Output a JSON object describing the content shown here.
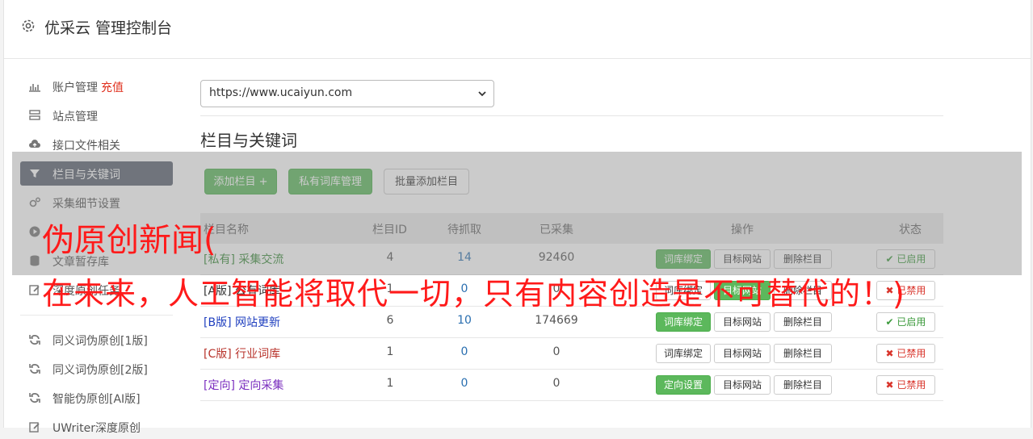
{
  "header": {
    "title": "优采云 管理控制台"
  },
  "sidebar": {
    "items": [
      {
        "label": "账户管理",
        "extra": "充值",
        "icon": "bar-chart-icon"
      },
      {
        "label": "站点管理",
        "icon": "server-icon"
      },
      {
        "label": "接口文件相关",
        "icon": "cloud-upload-icon"
      },
      {
        "label": "栏目与关键词",
        "icon": "filter-icon"
      },
      {
        "label": "采集细节设置",
        "icon": "cogs-icon"
      },
      {
        "label": "",
        "icon": "play-circle-icon"
      },
      {
        "label": "文章暂存库",
        "icon": "database-icon"
      },
      {
        "label": "深度原创任务",
        "icon": "edit-icon"
      },
      {
        "label": "同义词伪原创[1版]",
        "icon": "refresh-icon"
      },
      {
        "label": "同义词伪原创[2版]",
        "icon": "refresh-icon"
      },
      {
        "label": "智能伪原创[AI版]",
        "icon": "refresh-icon"
      },
      {
        "label": "UWriter深度原创",
        "icon": "edit-icon"
      }
    ]
  },
  "site_select": {
    "value": "https://www.ucaiyun.com"
  },
  "section_title": "栏目与关键词",
  "toolbar": {
    "add_column": "添加栏目 +",
    "private_lexicon": "私有词库管理",
    "batch_add": "批量添加栏目"
  },
  "table": {
    "headers": {
      "name": "栏目名称",
      "id": "栏目ID",
      "pending": "待抓取",
      "collected": "已采集",
      "actions": "操作",
      "status": "状态"
    },
    "rows": [
      {
        "name": "[私有] 采集交流",
        "id": "4",
        "pending": "14",
        "collected": "92460",
        "action1": "词库绑定",
        "action2": "目标网站",
        "action3": "删除栏目",
        "status": "已启用"
      },
      {
        "name": "[A版] 公有词库",
        "id": "1",
        "pending": "0",
        "collected": "0",
        "action1": "词库绑定",
        "action2": "目标网站",
        "action3": "删除栏目",
        "status": "已禁用"
      },
      {
        "name": "[B版] 网站更新",
        "id": "6",
        "pending": "10",
        "collected": "174669",
        "action1": "词库绑定",
        "action2": "目标网站",
        "action3": "删除栏目",
        "status": "已启用"
      },
      {
        "name": "[C版] 行业词库",
        "id": "1",
        "pending": "0",
        "collected": "0",
        "action1": "词库绑定",
        "action2": "目标网站",
        "action3": "删除栏目",
        "status": "已禁用"
      },
      {
        "name": "[定向] 定向采集",
        "id": "1",
        "pending": "0",
        "collected": "0",
        "action1": "定向设置",
        "action2": "目标网站",
        "action3": "删除栏目",
        "status": "已禁用"
      }
    ]
  },
  "overlay": {
    "line1": "伪原创新闻(",
    "line2": "在未来，人工智能将取代一切，只有内容创造是不可替代的！)"
  },
  "colors": {
    "accent_green": "#5cb85c",
    "sidebar_active": "#5a6270",
    "overlay_text": "#ff1a1a"
  }
}
